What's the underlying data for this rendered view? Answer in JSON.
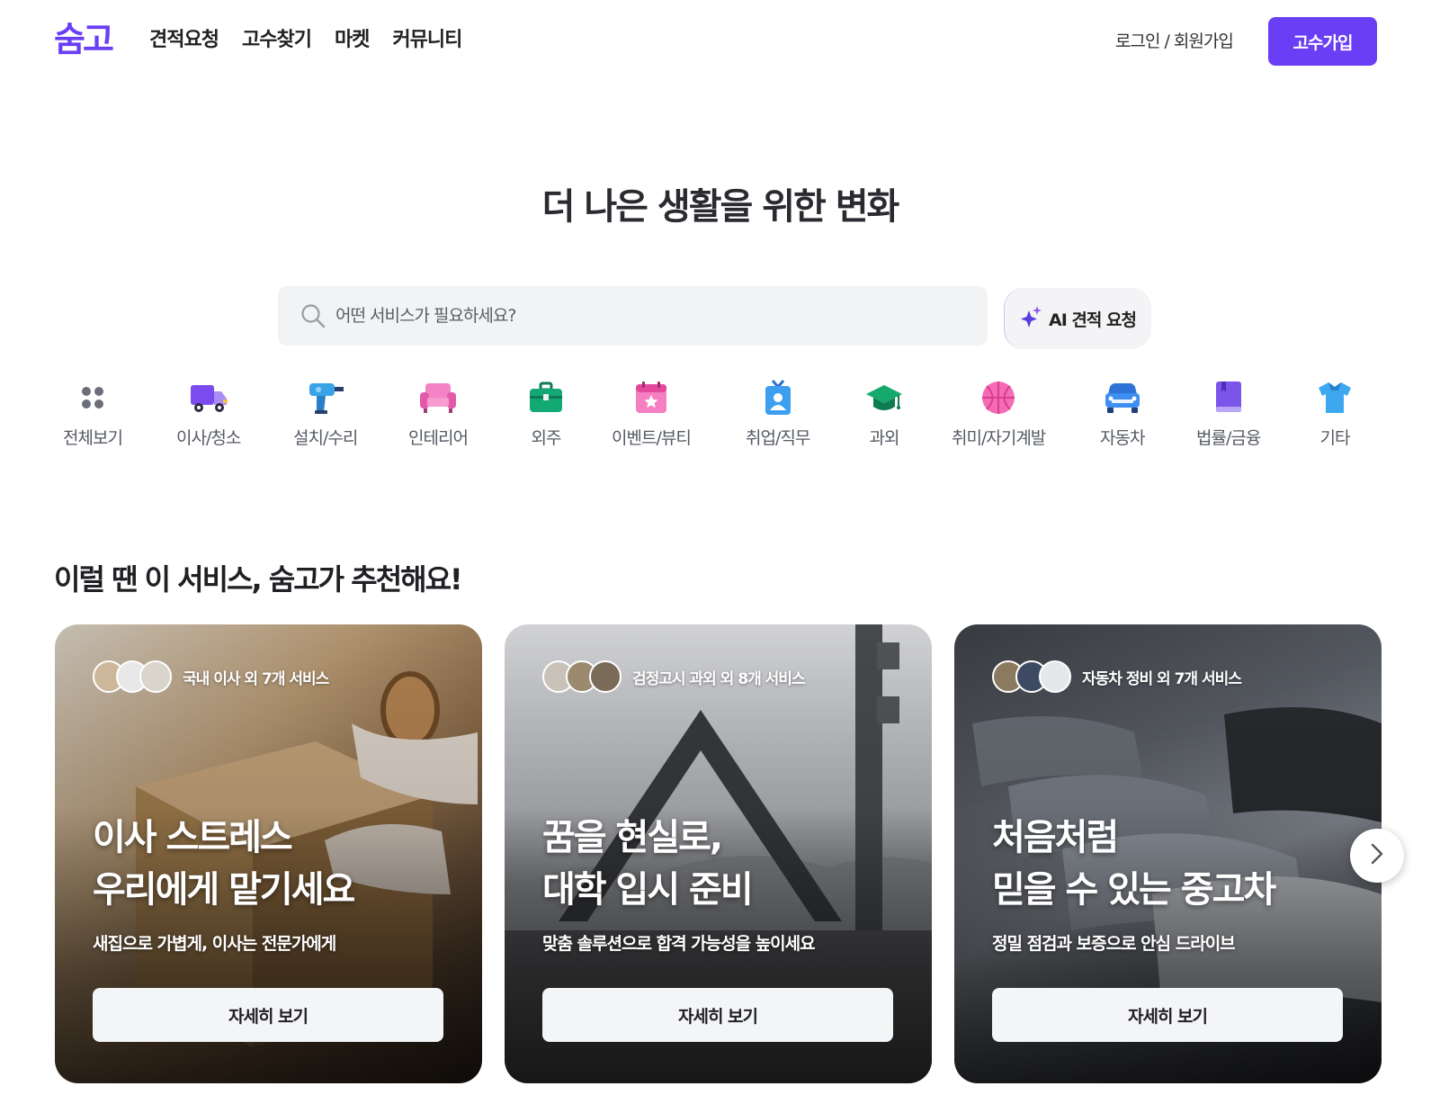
{
  "header": {
    "logo": "숨고",
    "nav": [
      "견적요청",
      "고수찾기",
      "마켓",
      "커뮤니티"
    ],
    "login": "로그인 / 회원가입",
    "pro_signup": "고수가입"
  },
  "hero": {
    "title": "더 나은 생활을 위한 변화",
    "search_placeholder": "어떤 서비스가 필요하세요?",
    "ai_button": "AI 견적 요청"
  },
  "categories": [
    {
      "label": "전체보기",
      "icon": "grid-dots-icon"
    },
    {
      "label": "이사/청소",
      "icon": "truck-icon"
    },
    {
      "label": "설치/수리",
      "icon": "drill-icon"
    },
    {
      "label": "인테리어",
      "icon": "sofa-icon"
    },
    {
      "label": "외주",
      "icon": "briefcase-icon"
    },
    {
      "label": "이벤트/뷰티",
      "icon": "calendar-star-icon"
    },
    {
      "label": "취업/직무",
      "icon": "id-badge-icon"
    },
    {
      "label": "과외",
      "icon": "graduation-cap-icon"
    },
    {
      "label": "취미/자기계발",
      "icon": "basketball-icon"
    },
    {
      "label": "자동차",
      "icon": "car-icon"
    },
    {
      "label": "법률/금융",
      "icon": "book-icon"
    },
    {
      "label": "기타",
      "icon": "shirt-icon"
    }
  ],
  "recommend": {
    "title": "이럴 땐 이 서비스, 숨고가 추천해요!",
    "cards": [
      {
        "tag": "국내 이사 외 7개 서비스",
        "title_line1": "이사 스트레스",
        "title_line2": "우리에게 맡기세요",
        "subtitle": "새집으로 가볍게, 이사는 전문가에게",
        "button": "자세히 보기"
      },
      {
        "tag": "검정고시 과외 외 8개 서비스",
        "title_line1": "꿈을 현실로,",
        "title_line2": "대학 입시 준비",
        "subtitle": "맞춤 솔루션으로 합격 가능성을 높이세요",
        "button": "자세히 보기"
      },
      {
        "tag": "자동차 정비 외 7개 서비스",
        "title_line1": "처음처럼",
        "title_line2": "믿을 수 있는 중고차",
        "subtitle": "정밀 점검과 보증으로 안심 드라이브",
        "button": "자세히 보기"
      }
    ]
  },
  "colors": {
    "brand": "#6a3ef5"
  }
}
